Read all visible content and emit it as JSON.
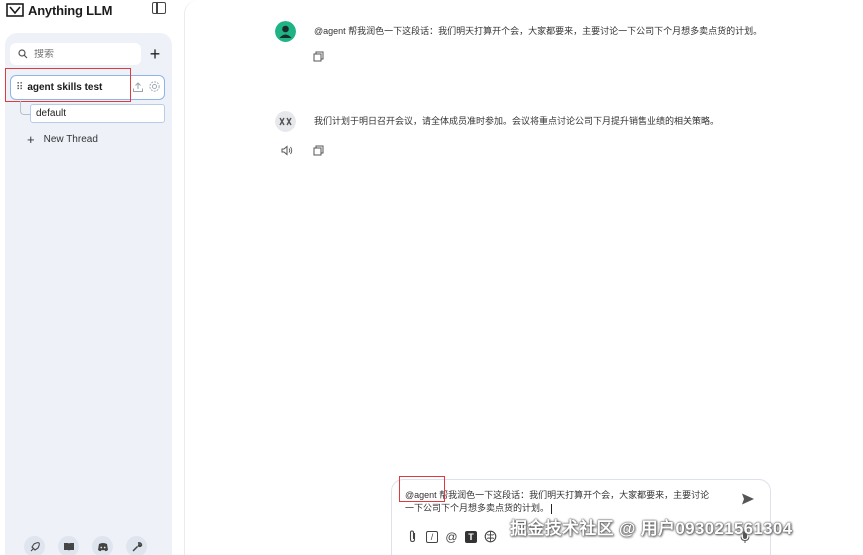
{
  "app": {
    "name": "Anything LLM"
  },
  "sidebar": {
    "search_placeholder": "搜索",
    "add_label": "+",
    "workspace": {
      "name": "agent skills test"
    },
    "threads": [
      {
        "label": "default"
      }
    ],
    "new_thread_label": "New Thread",
    "new_thread_plus": "+"
  },
  "chat": {
    "messages": [
      {
        "role": "user",
        "text": "@agent 帮我润色一下这段话：我们明天打算开个会，大家都要来，主要讨论一下公司下个月想多卖点货的计划。"
      },
      {
        "role": "assistant",
        "text": "我们计划于明日召开会议，请全体成员准时参加。会议将重点讨论公司下月提升销售业绩的相关策略。"
      }
    ]
  },
  "composer": {
    "line1": "@agent 帮我润色一下这段话：我们明天打算开个会，大家都要来，主要讨论",
    "line2": "一下公司下个月想多卖点货的计划。",
    "tool_at": "@",
    "tool_slash": "/",
    "tool_text": "T"
  },
  "watermark": "掘金技术社区 @ 用户093021561304",
  "colors": {
    "accent_blue": "#8fb4ec",
    "highlight_red": "#e0393e",
    "user_avatar": "#1fb386",
    "sidebar_panel": "#eef2f8"
  },
  "icons": [
    "sidebar-toggle-icon",
    "search-icon",
    "drag-handle-icon",
    "upload-icon",
    "gear-icon",
    "copy-icon",
    "speaker-icon",
    "send-icon",
    "paperclip-icon",
    "mic-icon"
  ]
}
